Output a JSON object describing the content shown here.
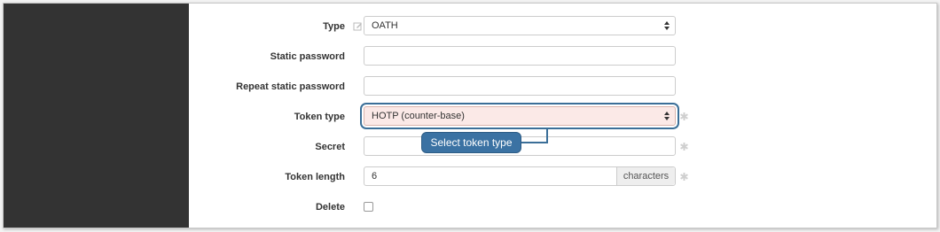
{
  "form": {
    "type": {
      "label": "Type",
      "value": "OATH"
    },
    "static_password": {
      "label": "Static password",
      "value": ""
    },
    "repeat_static_password": {
      "label": "Repeat static password",
      "value": ""
    },
    "token_type": {
      "label": "Token type",
      "value": "HOTP (counter-base)"
    },
    "secret": {
      "label": "Secret",
      "value": ""
    },
    "token_length": {
      "label": "Token length",
      "value": "6",
      "addon": "characters"
    },
    "delete": {
      "label": "Delete",
      "checked": false
    }
  },
  "callout": {
    "text": "Select token type"
  },
  "colors": {
    "sidebar": "#333333",
    "highlight": "#3b6f98",
    "callout_bg": "#3b72a3",
    "token_field_bg": "#fbe9e7"
  },
  "icons": {
    "type_edit": "edit-icon",
    "required": "asterisk-icon",
    "select": "select-arrows-icon"
  }
}
